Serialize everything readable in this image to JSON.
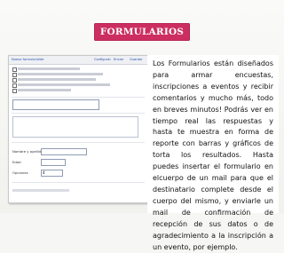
{
  "slide": {
    "title": "FORMULARIOS",
    "paragraph": "Los Formularios están diseñados para armar encuestas, inscripciones a eventos y recibir comentarios y mucho más, todo en breves minutos! Podrás ver en tiempo real las respuestas y hasta te muestra en forma de reporte con barras y gráficos de torta los resultados. Hasta puedes insertar el formulario en elcuerpo de un mail para que el destinatario complete desde el cuerpo del mismo, y enviarle un mail de confirmación de recepción de sus datos o de agradecimiento a la inscripción a un evento, por ejemplo."
  },
  "screenshot": {
    "top_links": [
      "Nuevo formulario",
      "Ver",
      "Configurar",
      "Enviar",
      "Guardar"
    ],
    "field_labels": [
      "Nombre y apellido",
      "Edad",
      "Opciones"
    ],
    "selected_value": "4"
  },
  "colors": {
    "accent": "#cc2e61",
    "link": "#2c4da8"
  }
}
